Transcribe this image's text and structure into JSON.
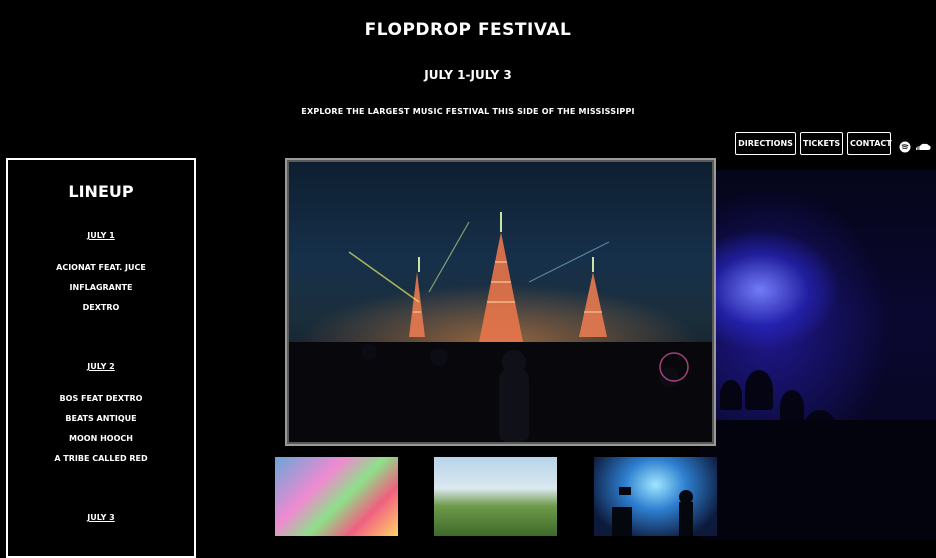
{
  "header": {
    "title": "FLOPDROP FESTIVAL",
    "dates": "JULY 1-JULY 3",
    "tagline": "EXPLORE THE LARGEST MUSIC FESTIVAL THIS SIDE OF THE MISSISSIPPI"
  },
  "nav": {
    "directions": "DIRECTIONS",
    "tickets": "TICKETS",
    "contact": "CONTACT",
    "icons": [
      "spotify-icon",
      "soundcloud-icon"
    ]
  },
  "lineup": {
    "title": "LINEUP",
    "days": [
      {
        "label": "JULY 1",
        "artists": [
          "ACIONAT FEAT. JUCE",
          "INFLAGRANTE",
          "DEXTRO"
        ]
      },
      {
        "label": "JULY 2",
        "artists": [
          "BOS FEAT DEXTRO",
          "BEATS ANTIQUE",
          "MOON HOOCH",
          "A TRIBE CALLED RED"
        ]
      },
      {
        "label": "JULY 3",
        "artists": []
      }
    ]
  },
  "colors": {
    "background": "#000000",
    "text": "#ffffff",
    "frame_border": "#9a9a9a"
  }
}
